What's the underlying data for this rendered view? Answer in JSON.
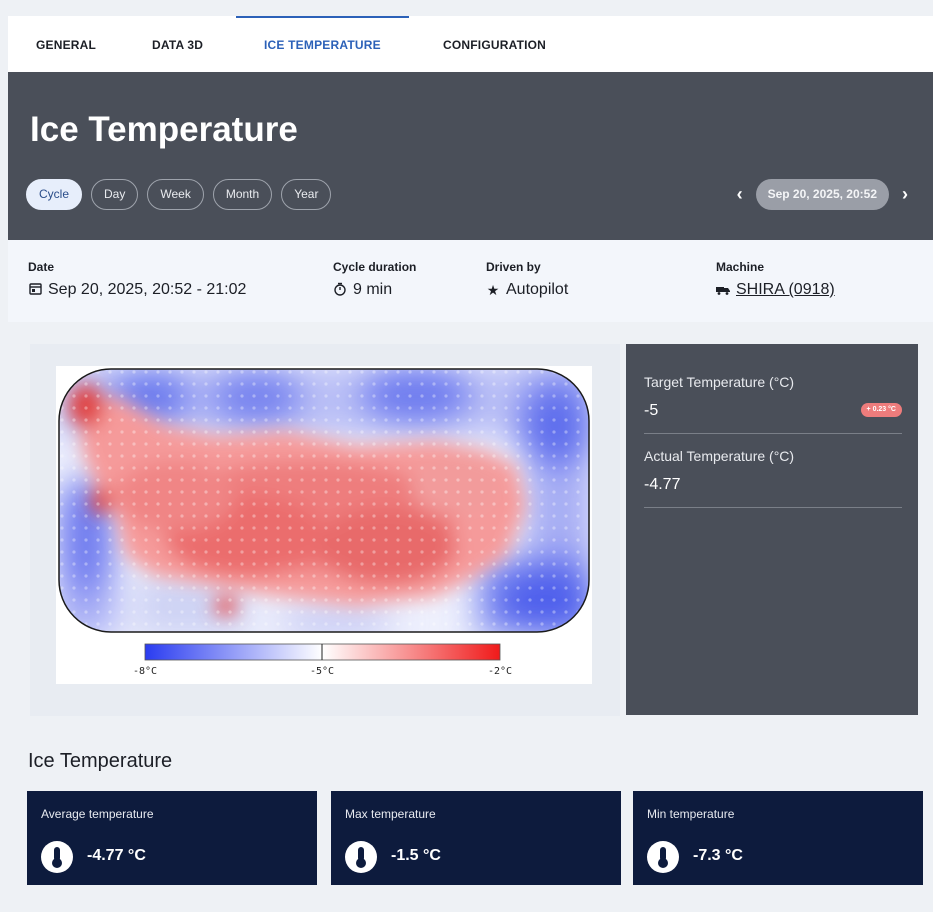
{
  "tabs": [
    {
      "label": "GENERAL"
    },
    {
      "label": "DATA 3D"
    },
    {
      "label": "ICE TEMPERATURE"
    },
    {
      "label": "CONFIGURATION"
    }
  ],
  "header": {
    "title": "Ice Temperature",
    "ranges": [
      "Cycle",
      "Day",
      "Week",
      "Month",
      "Year"
    ],
    "selected_range": "Cycle",
    "selected_date": "Sep 20, 2025, 20:52"
  },
  "info": {
    "date_label": "Date",
    "date_value": "Sep 20, 2025, 20:52 - 21:02",
    "duration_label": "Cycle duration",
    "duration_value": "9 min",
    "driven_label": "Driven by",
    "driven_value": "Autopilot",
    "machine_label": "Machine",
    "machine_value": "SHIRA (0918)"
  },
  "heatmap": {
    "scale_labels": [
      "-8°C",
      "-5°C",
      "-2°C"
    ],
    "colors": {
      "cold": "#2a3cf0",
      "neutral": "#ffffff",
      "warm": "#f01a1a"
    }
  },
  "panel": {
    "target_label": "Target Temperature (°C)",
    "target_value": "-5",
    "delta_badge": "+ 0.23 °C",
    "actual_label": "Actual Temperature (°C)",
    "actual_value": "-4.77"
  },
  "section_title": "Ice Temperature",
  "cards": [
    {
      "label": "Average temperature",
      "value": "-4.77 °C"
    },
    {
      "label": "Max temperature",
      "value": "-1.5 °C"
    },
    {
      "label": "Min temperature",
      "value": "-7.3 °C"
    }
  ],
  "colors": {
    "accent": "#2c61b8",
    "header_bg": "#4a4f59",
    "card_bg": "#0d1b3d",
    "badge": "#ee7c7c"
  }
}
